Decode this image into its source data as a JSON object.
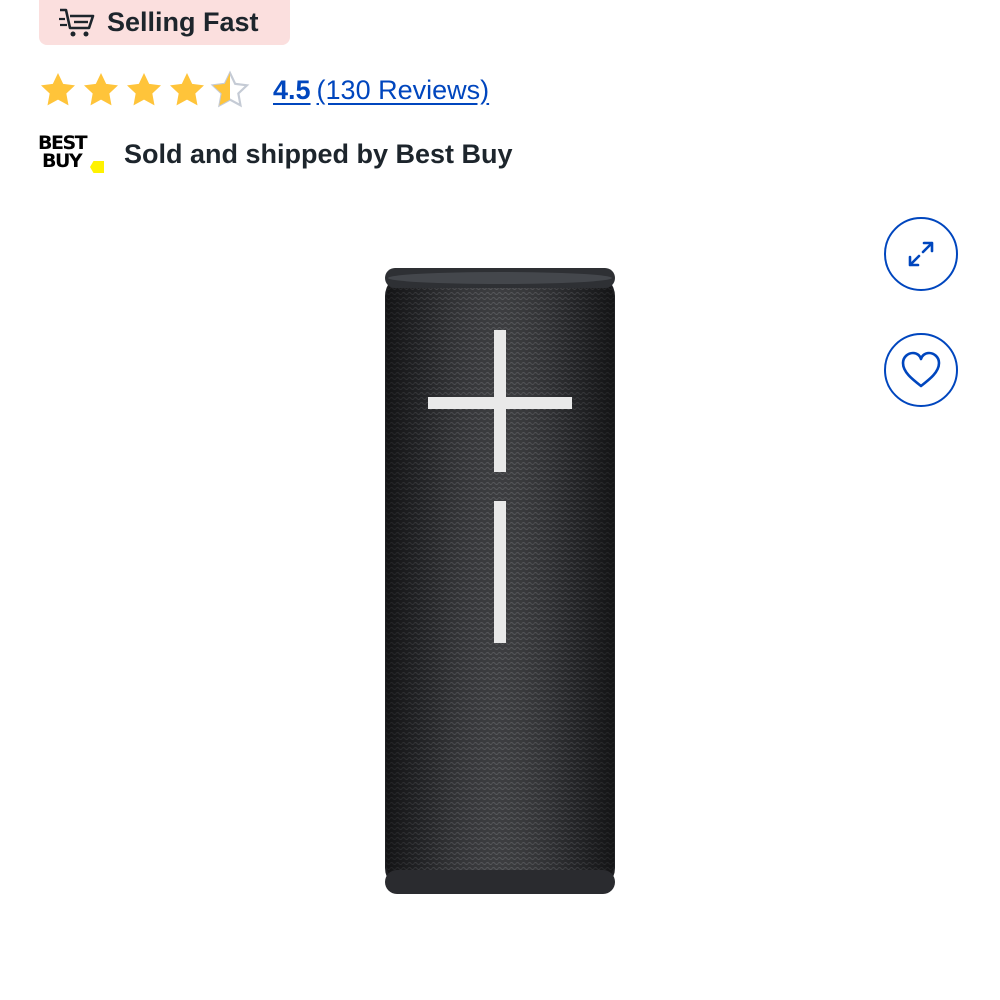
{
  "badge": {
    "label": "Selling Fast",
    "icon": "cart-icon",
    "bg_color": "#fbdfde"
  },
  "rating": {
    "value": "4.5",
    "reviews_text": "(130 Reviews)",
    "stars_out_of_5": 4.5,
    "star_color": "#ffc43a",
    "link_color": "#0046be"
  },
  "seller": {
    "logo_line1": "BEST",
    "logo_line2": "BUY",
    "text": "Sold and shipped by Best Buy"
  },
  "actions": {
    "expand_icon": "expand-icon",
    "wishlist_icon": "heart-icon",
    "accent": "#0046be"
  },
  "product": {
    "image": "black-cylindrical-bluetooth-speaker"
  }
}
